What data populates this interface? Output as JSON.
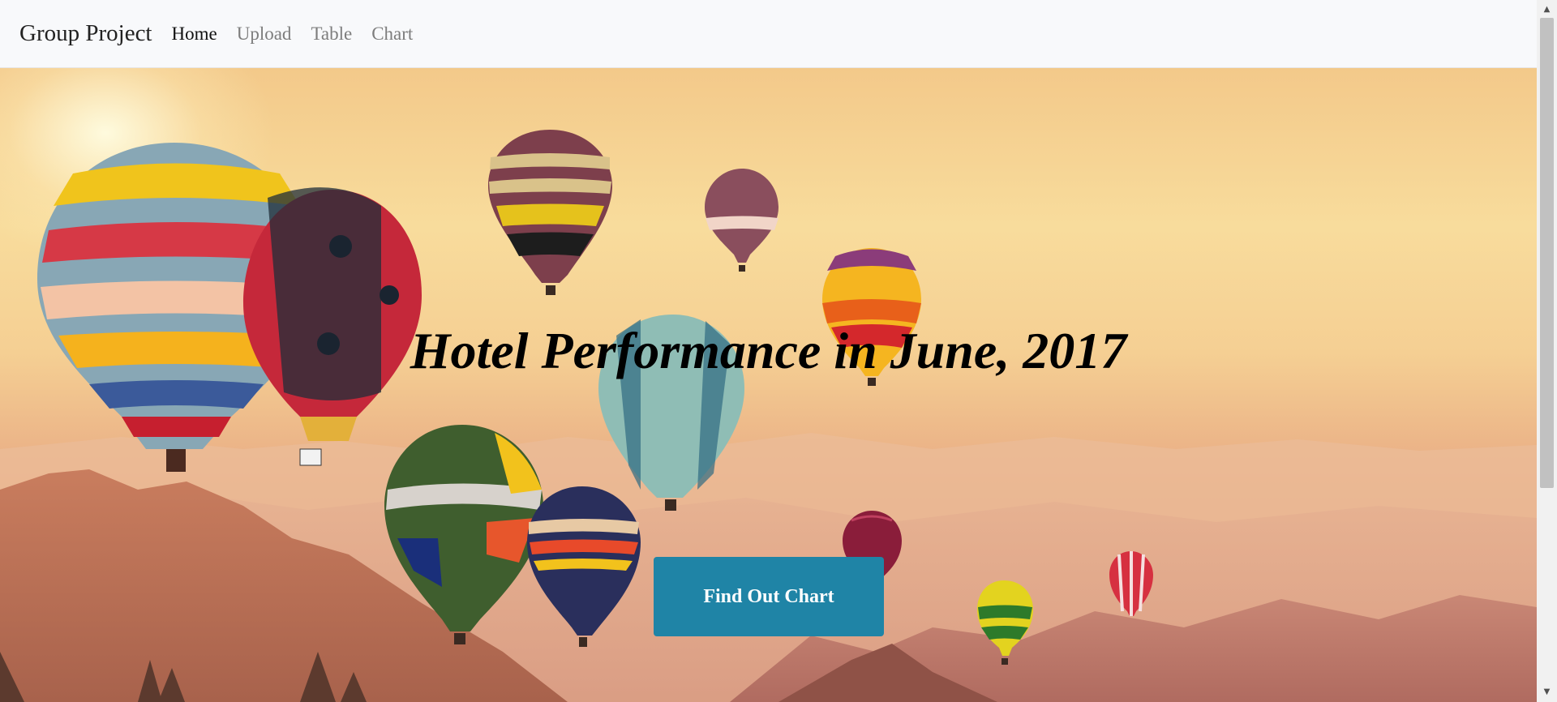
{
  "navbar": {
    "brand": "Group Project",
    "links": [
      {
        "label": "Home",
        "active": true
      },
      {
        "label": "Upload",
        "active": false
      },
      {
        "label": "Table",
        "active": false
      },
      {
        "label": "Chart",
        "active": false
      }
    ]
  },
  "hero": {
    "title": "Hotel Performance in June, 2017",
    "button_label": "Find Out Chart",
    "background_image": "hot-air-balloons-over-mountains-at-sunset"
  },
  "colors": {
    "navbar_bg": "#f8f9fb",
    "button_bg": "#1f84a6",
    "active_link": "#111111",
    "inactive_link": "#7d7d7d"
  },
  "scrollbar": {
    "up_icon": "triangle-up-icon",
    "down_icon": "triangle-down-icon"
  }
}
